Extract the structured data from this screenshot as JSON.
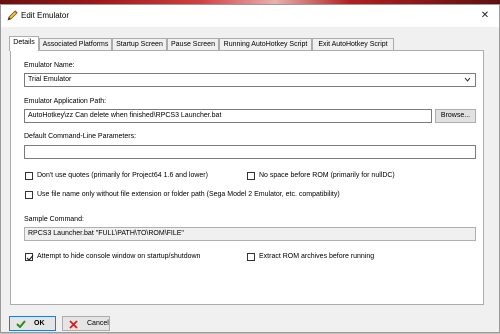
{
  "window": {
    "title": "Edit Emulator",
    "close_glyph": "✕"
  },
  "tabs": [
    {
      "label": "Details",
      "active": true
    },
    {
      "label": "Associated Platforms"
    },
    {
      "label": "Startup Screen"
    },
    {
      "label": "Pause Screen"
    },
    {
      "label": "Running AutoHotkey Script"
    },
    {
      "label": "Exit AutoHotkey Script"
    }
  ],
  "details": {
    "emulator_name_label": "Emulator Name:",
    "emulator_name_value": "Trial Emulator",
    "app_path_label": "Emulator Application Path:",
    "app_path_value": "AutoHotkey\\zz Can delete when finished\\RPCS3 Launcher.bat",
    "browse_label": "Browse...",
    "cmdline_label": "Default Command-Line Parameters:",
    "cmdline_value": "",
    "dont_use_quotes": {
      "label": "Don't use quotes (primarily for Project64 1.6 and lower)",
      "checked": false
    },
    "no_space_before_rom": {
      "label": "No space before ROM (primarily for nullDC)",
      "checked": false
    },
    "file_name_only": {
      "label": "Use file name only without file extension or folder path (Sega Model 2 Emulator, etc. compatibility)",
      "checked": false
    },
    "sample_command_label": "Sample Command:",
    "sample_command_value": "RPCS3 Launcher.bat \"FULL\\PATH\\TO\\ROM\\FILE\"",
    "hide_console": {
      "label": "Attempt to hide console window on startup/shutdown",
      "checked": true
    },
    "extract_rom": {
      "label": "Extract ROM archives before running",
      "checked": false
    }
  },
  "footer": {
    "ok_label": "OK",
    "cancel_label": "Cancel"
  },
  "colors": {
    "ok_check": "#2e8b22",
    "cancel_x": "#d42020",
    "focus_border": "#2f78c8",
    "title_icon": "#c04020"
  },
  "icons": [
    "pencil-icon",
    "close-icon",
    "chevron-down-icon",
    "checkmark-icon",
    "x-icon"
  ]
}
